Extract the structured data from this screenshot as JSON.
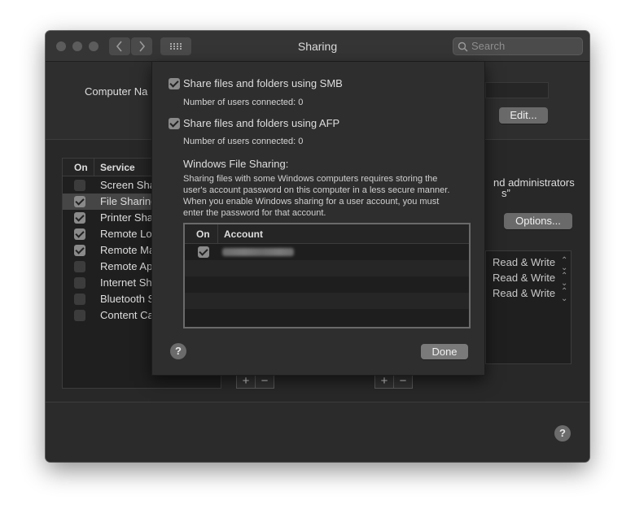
{
  "window": {
    "title": "Sharing",
    "search_placeholder": "Search"
  },
  "main": {
    "computer_name_label": "Computer Na",
    "edit_button": "Edit...",
    "admins_fragment": "nd administrators",
    "quote_fragment": "s”",
    "options_button": "Options...",
    "service_list": {
      "header_on": "On",
      "header_service": "Service",
      "items": [
        {
          "label": "Screen Sha",
          "checked": false
        },
        {
          "label": "File Sharing",
          "checked": true
        },
        {
          "label": "Printer Sha",
          "checked": true
        },
        {
          "label": "Remote Log",
          "checked": true
        },
        {
          "label": "Remote Ma",
          "checked": true
        },
        {
          "label": "Remote Ap",
          "checked": false
        },
        {
          "label": "Internet Sh",
          "checked": false
        },
        {
          "label": "Bluetooth S",
          "checked": false
        },
        {
          "label": "Content Ca",
          "checked": false
        }
      ]
    },
    "permissions": [
      "Read & Write",
      "Read & Write",
      "Read & Write"
    ],
    "plus": "+",
    "minus": "−",
    "help": "?"
  },
  "sheet": {
    "smb_label": "Share files and folders using SMB",
    "smb_users": "Number of users connected: 0",
    "afp_label": "Share files and folders using AFP",
    "afp_users": "Number of users connected: 0",
    "wfs_title": "Windows File Sharing:",
    "wfs_description": "Sharing files with some Windows computers requires storing the user's account password on this computer in a less secure manner. When you enable Windows sharing for a user account, you must enter the password for that account.",
    "table_header_on": "On",
    "table_header_account": "Account",
    "help": "?",
    "done_button": "Done"
  },
  "icons": {
    "back": "chevron-left-icon",
    "forward": "chevron-right-icon",
    "grid": "grid-icon",
    "search": "search-icon",
    "help": "question-mark-icon"
  }
}
